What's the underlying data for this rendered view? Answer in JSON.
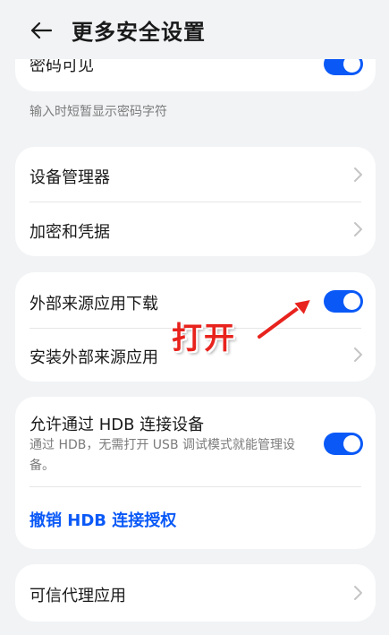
{
  "header": {
    "title": "更多安全设置"
  },
  "card1": {
    "label": "密码可见",
    "toggle_on": true
  },
  "caption": "输入时短暂显示密码字符",
  "card2": {
    "items": [
      {
        "label": "设备管理器"
      },
      {
        "label": "加密和凭据"
      }
    ]
  },
  "card3": {
    "items": [
      {
        "label": "外部来源应用下载",
        "toggle_on": true
      },
      {
        "label": "安装外部来源应用"
      }
    ]
  },
  "annotation": "打开",
  "card4": {
    "label": "允许通过 HDB 连接设备",
    "description": "通过 HDB，无需打开 USB 调试模式就能管理设备。",
    "toggle_on": true,
    "link": "撤销 HDB 连接授权"
  },
  "card5": {
    "label": "可信代理应用"
  },
  "colors": {
    "accent": "#0a59f7",
    "background": "#f1f3f5",
    "annotation": "#e8231d"
  }
}
